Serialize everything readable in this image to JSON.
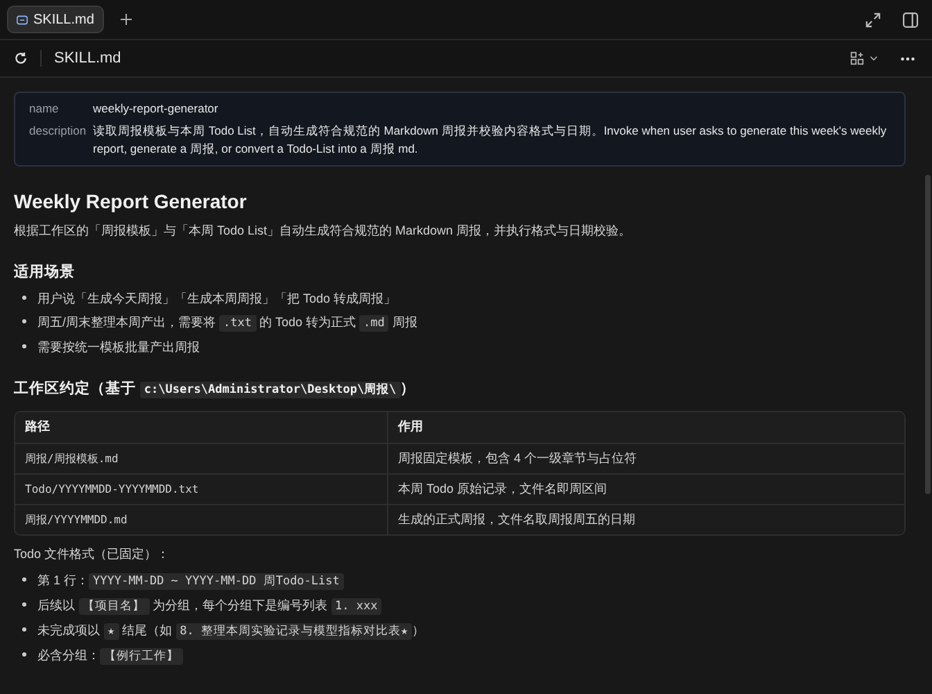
{
  "tabs": [
    {
      "label": "SKILL.md",
      "selected": true
    }
  ],
  "toolbar": {
    "title": "SKILL.md"
  },
  "frontmatter": [
    {
      "key": "name",
      "value": "weekly-report-generator"
    },
    {
      "key": "description",
      "value": "读取周报模板与本周 Todo List，自动生成符合规范的 Markdown 周报并校验内容格式与日期。Invoke when user asks to generate this week's weekly report, generate a 周报, or convert a Todo-List into a 周报 md."
    }
  ],
  "title": "Weekly Report Generator",
  "intro": "根据工作区的「周报模板」与「本周 Todo List」自动生成符合规范的 Markdown 周报，并执行格式与日期校验。",
  "sections": [
    {
      "heading": [
        {
          "text": "适用场景",
          "code": false
        }
      ],
      "items": [
        [
          {
            "text": "用户说「生成今天周报」「生成本周周报」「把 Todo 转成周报」",
            "code": false
          }
        ],
        [
          {
            "text": "周五/周末整理本周产出，需要将 ",
            "code": false
          },
          {
            "text": ".txt",
            "code": true
          },
          {
            "text": " 的 Todo 转为正式 ",
            "code": false
          },
          {
            "text": ".md",
            "code": true
          },
          {
            "text": " 周报",
            "code": false
          }
        ],
        [
          {
            "text": "需要按统一模板批量产出周报",
            "code": false
          }
        ]
      ]
    },
    {
      "heading": [
        {
          "text": "工作区约定（基于 ",
          "code": false
        },
        {
          "text": "c:\\Users\\Administrator\\Desktop\\周报\\",
          "code": true
        },
        {
          "text": "）",
          "code": false
        }
      ],
      "table": {
        "columns": [
          "路径",
          "作用"
        ],
        "rows": [
          [
            "周报/周报模板.md",
            "周报固定模板，包含 4 个一级章节与占位符"
          ],
          [
            "Todo/YYYYMMDD-YYYYMMDD.txt",
            "本周 Todo 原始记录，文件名即周区间"
          ],
          [
            "周报/YYYYMMDD.md",
            "生成的正式周报，文件名取周报周五的日期"
          ]
        ]
      },
      "note": "Todo 文件格式（已固定）：",
      "items": [
        [
          {
            "text": "第 1 行：",
            "code": false
          },
          {
            "text": "YYYY-MM-DD ~ YYYY-MM-DD 周Todo-List",
            "code": true
          }
        ],
        [
          {
            "text": "后续以 ",
            "code": false
          },
          {
            "text": "【项目名】",
            "code": true
          },
          {
            "text": " 为分组，每个分组下是编号列表 ",
            "code": false
          },
          {
            "text": "1. xxx",
            "code": true
          }
        ],
        [
          {
            "text": "未完成项以 ",
            "code": false
          },
          {
            "text": "★",
            "code": true
          },
          {
            "text": " 结尾（如 ",
            "code": false
          },
          {
            "text": "8. 整理本周实验记录与模型指标对比表★",
            "code": true
          },
          {
            "text": "）",
            "code": false
          }
        ],
        [
          {
            "text": "必含分组：",
            "code": false
          },
          {
            "text": "【例行工作】",
            "code": true
          }
        ]
      ]
    }
  ]
}
